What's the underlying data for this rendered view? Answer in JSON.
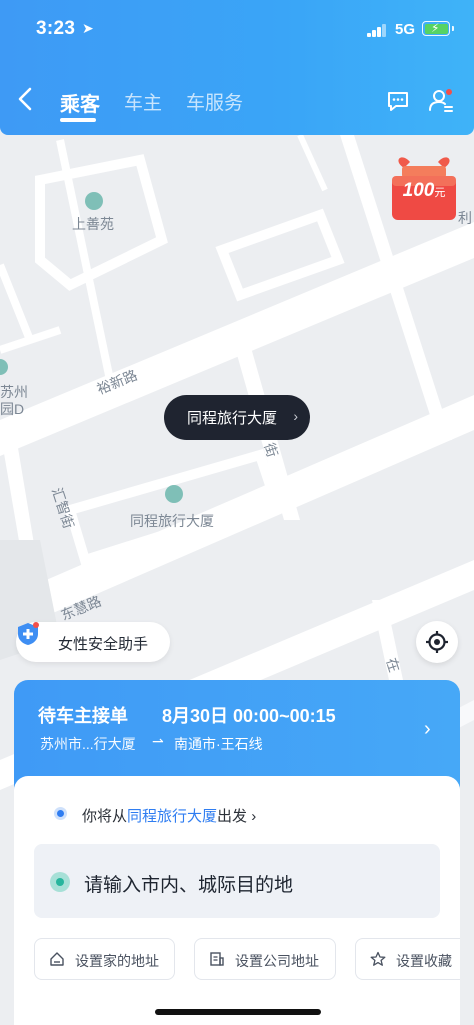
{
  "status_bar": {
    "time": "3:23",
    "network": "5G",
    "location_icon": "location-arrow-icon"
  },
  "nav": {
    "tabs": [
      {
        "label": "乘客",
        "active": true
      },
      {
        "label": "车主",
        "active": false
      },
      {
        "label": "车服务",
        "active": false
      }
    ],
    "icons": [
      "back-chevron-icon",
      "message-icon",
      "user-settings-icon"
    ]
  },
  "map": {
    "labels": {
      "poi_1": "上善苑",
      "road_1": "裕新路",
      "road_2": "汇智街",
      "road_3": "东慧路",
      "road_4": "街",
      "poi_2": "同程旅行大厦",
      "edge_1": "苏州",
      "edge_2": "园D",
      "edge_3": "在",
      "edge_4": "利"
    },
    "promo": {
      "amount": "100",
      "unit": "元"
    },
    "selected_place": "同程旅行大厦",
    "safety_button": "女性安全助手"
  },
  "trip": {
    "status": "待车主接单",
    "date_time": "8月30日 00:00~00:15",
    "from": "苏州市...行大厦",
    "to": "南通市·王石线"
  },
  "sheet": {
    "from_prefix": "你将从",
    "from_place": "同程旅行大厦",
    "from_suffix": "出发",
    "destination_placeholder": "请输入市内、城际目的地",
    "quick_actions": [
      {
        "label": "设置家的地址",
        "icon": "home-icon"
      },
      {
        "label": "设置公司地址",
        "icon": "office-icon"
      },
      {
        "label": "设置收藏",
        "icon": "star-icon"
      }
    ]
  },
  "colors": {
    "header_blue": "#3e9af5",
    "accent_blue": "#2f7df1",
    "dest_green": "#27b59d",
    "promo_red": "#f0524a"
  }
}
